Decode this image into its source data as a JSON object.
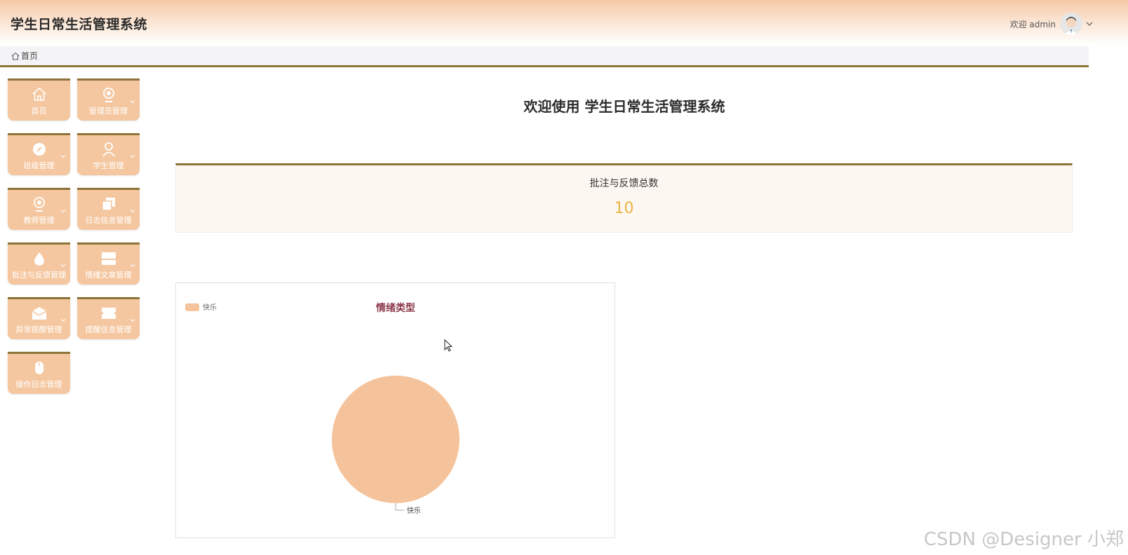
{
  "header": {
    "app_title": "学生日常生活管理系统",
    "welcome_text": "欢迎 admin",
    "avatar_icon": "user-avatar-icon",
    "dropdown_icon": "chevron-down-icon"
  },
  "breadcrumb": {
    "home_icon": "home-icon",
    "label": "首页"
  },
  "sidebar": {
    "items": [
      {
        "label": "首页",
        "icon": "home-icon",
        "has_submenu": false
      },
      {
        "label": "管理员管理",
        "icon": "admin-icon",
        "has_submenu": true
      },
      {
        "label": "班级管理",
        "icon": "compass-icon",
        "has_submenu": true
      },
      {
        "label": "学生管理",
        "icon": "person-icon",
        "has_submenu": true
      },
      {
        "label": "教师管理",
        "icon": "teacher-icon",
        "has_submenu": true
      },
      {
        "label": "日志信息管理",
        "icon": "copy-icon",
        "has_submenu": true
      },
      {
        "label": "批注与反馈管理",
        "icon": "drop-icon",
        "has_submenu": true
      },
      {
        "label": "情绪文章管理",
        "icon": "layout-icon",
        "has_submenu": true
      },
      {
        "label": "异常提醒管理",
        "icon": "mail-icon",
        "has_submenu": true
      },
      {
        "label": "提醒信息管理",
        "icon": "ticket-icon",
        "has_submenu": true
      },
      {
        "label": "操作日志管理",
        "icon": "mouse-icon",
        "has_submenu": false
      }
    ]
  },
  "main": {
    "welcome_title": "欢迎使用 学生日常生活管理系统",
    "stat_card": {
      "label": "批注与反馈总数",
      "value": "10"
    }
  },
  "chart_data": {
    "type": "pie",
    "title": "情绪类型",
    "legend": [
      "快乐"
    ],
    "legend_position": "top-left",
    "slices": [
      {
        "label": "快乐",
        "value": 1
      }
    ],
    "colors": [
      "#f5c39b"
    ]
  },
  "watermark": "CSDN @Designer 小郑",
  "colors": {
    "accent_border": "#8c7338",
    "tile_bg": "#f5c7a0",
    "stat_value": "#eab544",
    "chart_title": "#8b3a4a",
    "slice": "#f5c39b"
  }
}
